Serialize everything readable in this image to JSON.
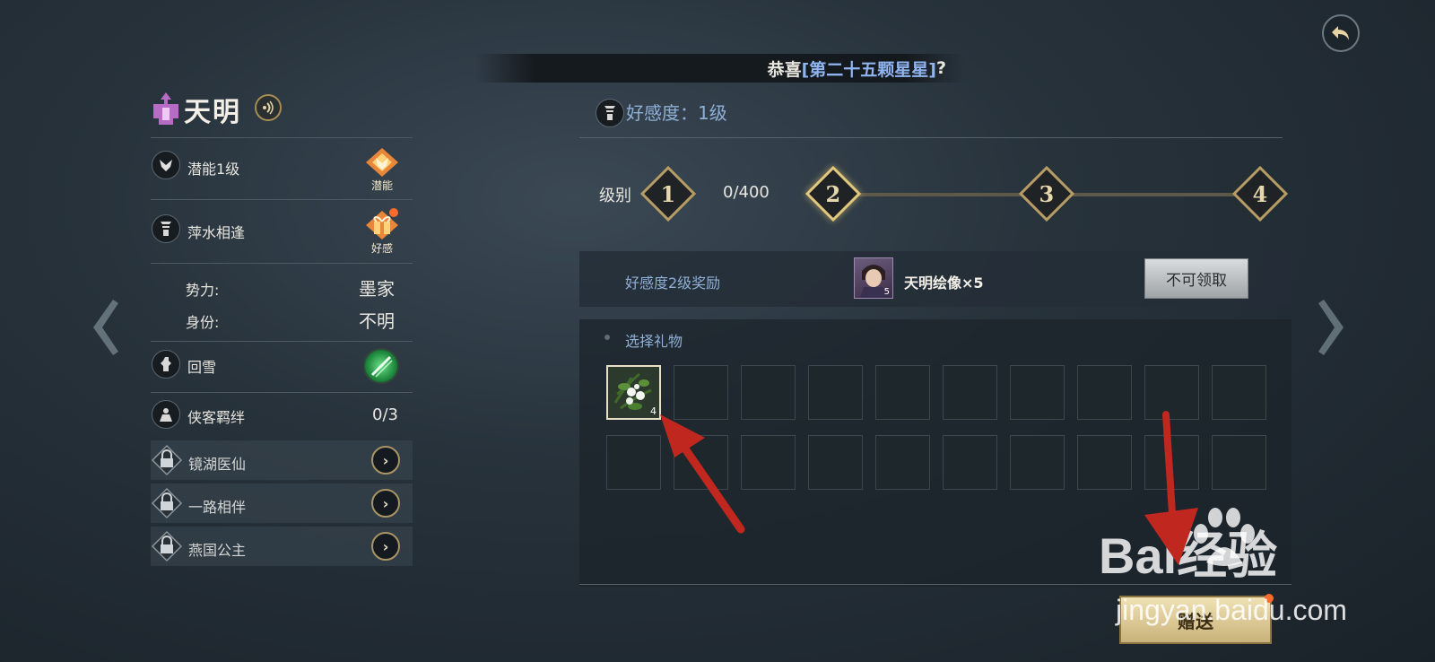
{
  "banner": {
    "prefix": "恭喜",
    "highlight": "[第二十五颗星星]",
    "suffix": "?"
  },
  "character": {
    "name": "天明"
  },
  "left_panel": {
    "potential": {
      "label": "潜能1级",
      "badge": "潜能"
    },
    "affinity": {
      "label": "萍水相逢",
      "badge": "好感"
    },
    "faction_label": "势力:",
    "faction_value": "墨家",
    "identity_label": "身份:",
    "identity_value": "不明",
    "skill": {
      "label": "回雪"
    },
    "bond": {
      "label": "侠客羁绊",
      "value": "0/3"
    },
    "sub_items": [
      {
        "label": "镜湖医仙"
      },
      {
        "label": "一路相伴"
      },
      {
        "label": "燕国公主"
      }
    ]
  },
  "affinity_panel": {
    "title": "好感度：1级",
    "level_label": "级别",
    "progress_text": "0/400",
    "levels": [
      "1",
      "2",
      "3",
      "4"
    ],
    "reward_label": "好感度2级奖励",
    "reward_name": "天明绘像×5",
    "reward_count": "5",
    "claim_button": "不可领取",
    "gift_title": "选择礼物",
    "gift_item_count": "4",
    "give_button": "赠送"
  },
  "watermark": {
    "brand": "Bai经验",
    "url": "jingyan.baidu.com"
  },
  "colors": {
    "accent_blue": "#8fb0d6",
    "gold": "#b69d66",
    "annotation_red": "#c0271f",
    "notification": "#ff6b2b"
  }
}
